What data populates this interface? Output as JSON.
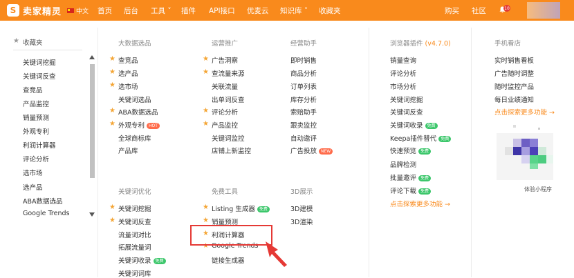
{
  "brand": {
    "name": "卖家精灵",
    "logo_letter": "S"
  },
  "lang": "中文",
  "nav": [
    "首页",
    "后台",
    "工具",
    "插件",
    "API接口",
    "优麦云",
    "知识库",
    "收藏夹"
  ],
  "nav_right": {
    "buy": "购买",
    "community": "社区",
    "notif_count": "10"
  },
  "sidebar": {
    "title": "收藏夹",
    "items": [
      "关键词挖掘",
      "关键词反查",
      "查竞品",
      "产品监控",
      "销量预测",
      "外观专利",
      "利润计算器",
      "评论分析",
      "选市场",
      "选产品",
      "ABA数据选品",
      "Google Trends"
    ]
  },
  "sections": {
    "bigdata": {
      "title": "大数据选品",
      "items": [
        {
          "label": "查竞品",
          "star": true
        },
        {
          "label": "选产品",
          "star": true
        },
        {
          "label": "选市场",
          "star": true
        },
        {
          "label": "关键词选品",
          "star": false
        },
        {
          "label": "ABA数据选品",
          "star": true
        },
        {
          "label": "外观专利",
          "star": true,
          "tag": "HOT"
        },
        {
          "label": "全球商标库",
          "star": false
        },
        {
          "label": "产品库",
          "star": false
        }
      ]
    },
    "ops": {
      "title": "运营推广",
      "items": [
        {
          "label": "广告洞察",
          "star": true
        },
        {
          "label": "查流量来源",
          "star": true
        },
        {
          "label": "关联流量",
          "star": false
        },
        {
          "label": "出单词反查",
          "star": false
        },
        {
          "label": "评论分析",
          "star": true
        },
        {
          "label": "产品监控",
          "star": true
        },
        {
          "label": "关键词监控",
          "star": false
        },
        {
          "label": "店铺上新监控",
          "star": false
        }
      ]
    },
    "helper": {
      "title": "经营助手",
      "items": [
        {
          "label": "即时销售"
        },
        {
          "label": "商品分析"
        },
        {
          "label": "订单列表"
        },
        {
          "label": "库存分析"
        },
        {
          "label": "索赔助手"
        },
        {
          "label": "跟卖监控"
        },
        {
          "label": "自动邀评"
        },
        {
          "label": "广告投放",
          "tag": "NEW"
        }
      ]
    },
    "keyword": {
      "title": "关键词优化",
      "items": [
        {
          "label": "关键词挖掘",
          "star": true
        },
        {
          "label": "关键词反查",
          "star": true
        },
        {
          "label": "流量词对比",
          "star": false
        },
        {
          "label": "拓展流量词",
          "star": false
        },
        {
          "label": "关键词收录",
          "star": false,
          "tag": "免费"
        },
        {
          "label": "关键词词库",
          "star": false
        }
      ]
    },
    "free": {
      "title": "免费工具",
      "items": [
        {
          "label": "Listing 生成器",
          "star": true,
          "tag": "免费"
        },
        {
          "label": "销量预测",
          "star": true
        },
        {
          "label": "利润计算器",
          "star": true
        },
        {
          "label": "Google Trends",
          "star": true
        },
        {
          "label": "链接生成器",
          "star": false
        }
      ]
    },
    "display3d": {
      "title": "3D展示",
      "items": [
        {
          "label": "3D建模"
        },
        {
          "label": "3D渲染"
        }
      ]
    },
    "browser": {
      "title": "浏览器插件",
      "version": "(v4.7.0)",
      "items": [
        {
          "label": "销量查询"
        },
        {
          "label": "评论分析"
        },
        {
          "label": "市场分析"
        },
        {
          "label": "关键词挖掘"
        },
        {
          "label": "关键词反查"
        },
        {
          "label": "关键词收录",
          "tag": "免费"
        },
        {
          "label": "Keepa插件替代",
          "tag": "免费"
        },
        {
          "label": "快速预览",
          "tag": "免费"
        },
        {
          "label": "品牌检测"
        },
        {
          "label": "批量邀评",
          "tag": "免费"
        },
        {
          "label": "评论下载",
          "tag": "免费"
        }
      ],
      "more": "点击探索更多功能 →"
    },
    "mobile": {
      "title": "手机看店",
      "items": [
        {
          "label": "实时销售看板"
        },
        {
          "label": "广告随时调整"
        },
        {
          "label": "随时监控产品"
        },
        {
          "label": "每日业绩通知"
        }
      ],
      "more": "点击探索更多功能 →",
      "qr_caption": "体验小程序"
    }
  },
  "colors": {
    "brand": "#f98a1c",
    "star": "#f4a534",
    "highlight": "#e53935"
  }
}
